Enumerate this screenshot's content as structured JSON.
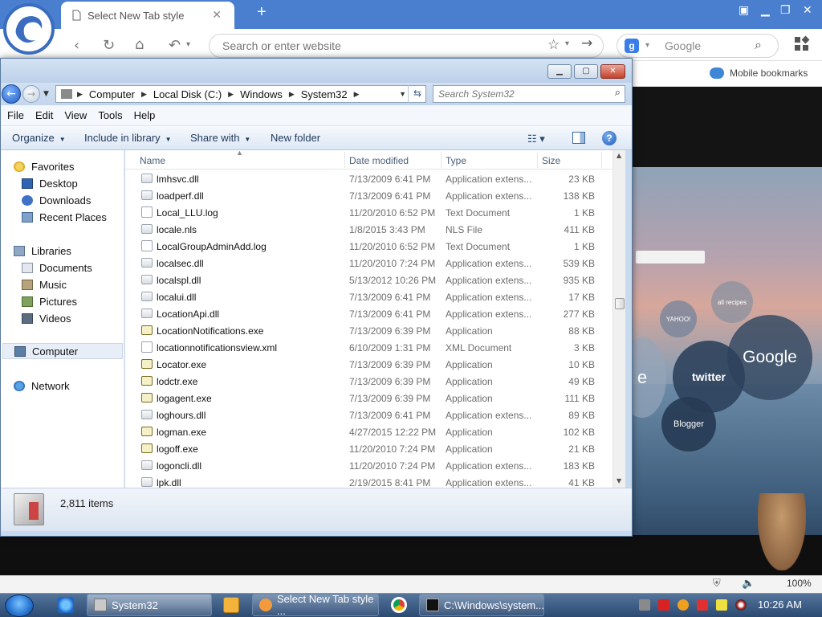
{
  "browser": {
    "tab_title": "Select New Tab style",
    "address_placeholder": "Search or enter website",
    "search_engine": "Google",
    "mobile_bookmarks": "Mobile bookmarks",
    "zoom": "100%"
  },
  "ntp": {
    "dials": [
      "Google",
      "twitter",
      "Blogger",
      "YAHOO!",
      "all recipes",
      "e"
    ]
  },
  "explorer": {
    "breadcrumb": [
      "Computer",
      "Local Disk (C:)",
      "Windows",
      "System32"
    ],
    "search_placeholder": "Search System32",
    "menu": [
      "File",
      "Edit",
      "View",
      "Tools",
      "Help"
    ],
    "commands": {
      "organize": "Organize",
      "include": "Include in library",
      "share": "Share with",
      "new_folder": "New folder"
    },
    "columns": {
      "name": "Name",
      "date": "Date modified",
      "type": "Type",
      "size": "Size"
    },
    "nav": {
      "favorites": "Favorites",
      "desktop": "Desktop",
      "downloads": "Downloads",
      "recent": "Recent Places",
      "libraries": "Libraries",
      "documents": "Documents",
      "music": "Music",
      "pictures": "Pictures",
      "videos": "Videos",
      "computer": "Computer",
      "network": "Network"
    },
    "files": [
      {
        "name": "lmhsvc.dll",
        "date": "7/13/2009 6:41 PM",
        "type": "Application extens...",
        "size": "23 KB",
        "kind": "dll"
      },
      {
        "name": "loadperf.dll",
        "date": "7/13/2009 6:41 PM",
        "type": "Application extens...",
        "size": "138 KB",
        "kind": "dll"
      },
      {
        "name": "Local_LLU.log",
        "date": "11/20/2010 6:52 PM",
        "type": "Text Document",
        "size": "1 KB",
        "kind": "doc"
      },
      {
        "name": "locale.nls",
        "date": "1/8/2015 3:43 PM",
        "type": "NLS File",
        "size": "411 KB",
        "kind": "dll"
      },
      {
        "name": "LocalGroupAdminAdd.log",
        "date": "11/20/2010 6:52 PM",
        "type": "Text Document",
        "size": "1 KB",
        "kind": "doc"
      },
      {
        "name": "localsec.dll",
        "date": "11/20/2010 7:24 PM",
        "type": "Application extens...",
        "size": "539 KB",
        "kind": "dll"
      },
      {
        "name": "localspl.dll",
        "date": "5/13/2012 10:26 PM",
        "type": "Application extens...",
        "size": "935 KB",
        "kind": "dll"
      },
      {
        "name": "localui.dll",
        "date": "7/13/2009 6:41 PM",
        "type": "Application extens...",
        "size": "17 KB",
        "kind": "dll"
      },
      {
        "name": "LocationApi.dll",
        "date": "7/13/2009 6:41 PM",
        "type": "Application extens...",
        "size": "277 KB",
        "kind": "dll"
      },
      {
        "name": "LocationNotifications.exe",
        "date": "7/13/2009 6:39 PM",
        "type": "Application",
        "size": "88 KB",
        "kind": "exe"
      },
      {
        "name": "locationnotificationsview.xml",
        "date": "6/10/2009 1:31 PM",
        "type": "XML Document",
        "size": "3 KB",
        "kind": "doc"
      },
      {
        "name": "Locator.exe",
        "date": "7/13/2009 6:39 PM",
        "type": "Application",
        "size": "10 KB",
        "kind": "exe"
      },
      {
        "name": "lodctr.exe",
        "date": "7/13/2009 6:39 PM",
        "type": "Application",
        "size": "49 KB",
        "kind": "exe"
      },
      {
        "name": "logagent.exe",
        "date": "7/13/2009 6:39 PM",
        "type": "Application",
        "size": "111 KB",
        "kind": "exe"
      },
      {
        "name": "loghours.dll",
        "date": "7/13/2009 6:41 PM",
        "type": "Application extens...",
        "size": "89 KB",
        "kind": "dll"
      },
      {
        "name": "logman.exe",
        "date": "4/27/2015 12:22 PM",
        "type": "Application",
        "size": "102 KB",
        "kind": "exe"
      },
      {
        "name": "logoff.exe",
        "date": "11/20/2010 7:24 PM",
        "type": "Application",
        "size": "21 KB",
        "kind": "exe"
      },
      {
        "name": "logoncli.dll",
        "date": "11/20/2010 7:24 PM",
        "type": "Application extens...",
        "size": "183 KB",
        "kind": "dll"
      },
      {
        "name": "lpk.dll",
        "date": "2/19/2015 8:41 PM",
        "type": "Application extens...",
        "size": "41 KB",
        "kind": "dll"
      }
    ],
    "item_count": "2,811 items",
    "scroll_position": 0.45
  },
  "taskbar": {
    "items": [
      "System32",
      "Select New Tab style ...",
      "C:\\Windows\\system..."
    ],
    "clock": "10:26 AM"
  },
  "colors": {
    "browser_blue": "#4a7fd0",
    "selection": "#e8eef7",
    "taskbar": "#2c4a72"
  }
}
